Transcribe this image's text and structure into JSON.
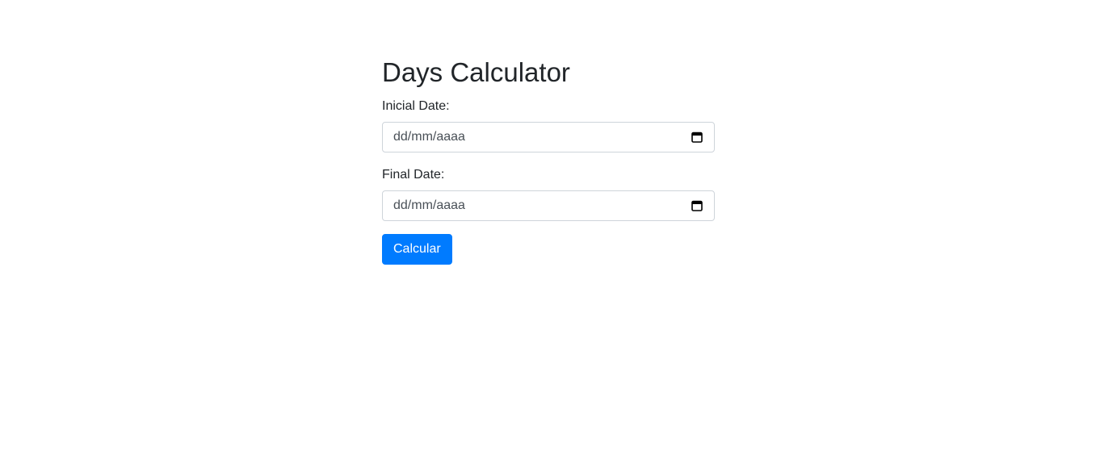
{
  "page": {
    "title": "Days Calculator"
  },
  "form": {
    "initial_date": {
      "label": "Inicial Date:",
      "placeholder": "dd/mm/aaaa",
      "icon": "calendar-icon"
    },
    "final_date": {
      "label": "Final Date:",
      "placeholder": "dd/mm/aaaa",
      "icon": "calendar-icon"
    },
    "submit_label": "Calcular"
  },
  "colors": {
    "button_bg": "#007bff",
    "button_text": "#ffffff",
    "text": "#212529",
    "input_border": "#ced4da"
  }
}
